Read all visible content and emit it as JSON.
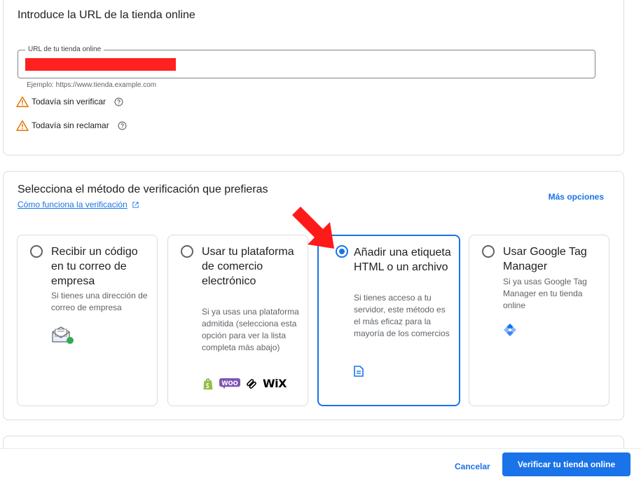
{
  "url_section": {
    "title": "Introduce la URL de la tienda online",
    "field_label": "URL de tu tienda online",
    "helper": "Ejemplo: https://www.tienda.example.com",
    "status_verify": "Todavía sin verificar",
    "status_claim": "Todavía sin reclamar"
  },
  "method_section": {
    "title": "Selecciona el método de verificación que prefieras",
    "how_link": "Cómo funciona la verificación",
    "more_options": "Más opciones",
    "options": [
      {
        "title": "Recibir un código en tu correo de empresa",
        "desc": "Si tienes una dirección de correo de empresa",
        "selected": false,
        "icon": "email-envelope-icon"
      },
      {
        "title": "Usar tu plataforma de comercio electrónico",
        "desc": "Si ya usas una plataforma admitida (selecciona esta opción para ver la lista completa más abajo)",
        "selected": false,
        "logos": [
          "shopify-icon",
          "woocommerce-icon",
          "squarespace-icon"
        ],
        "wix": "WiX"
      },
      {
        "title": "Añadir una etiqueta HTML o un archivo",
        "desc": "Si tienes acceso a tu servidor, este método es el más eficaz para la mayoría de los comercios",
        "selected": true,
        "icon": "document-icon"
      },
      {
        "title": "Usar Google Tag Manager",
        "desc": "Si ya usas Google Tag Manager en tu tienda online",
        "selected": false,
        "icon": "google-tag-manager-icon"
      }
    ]
  },
  "footer": {
    "cancel": "Cancelar",
    "verify": "Verificar tu tienda online"
  },
  "colors": {
    "accent": "#1a73e8",
    "warning": "#e37400",
    "redaction": "#ff2020",
    "arrow": "#ff1a1a"
  }
}
